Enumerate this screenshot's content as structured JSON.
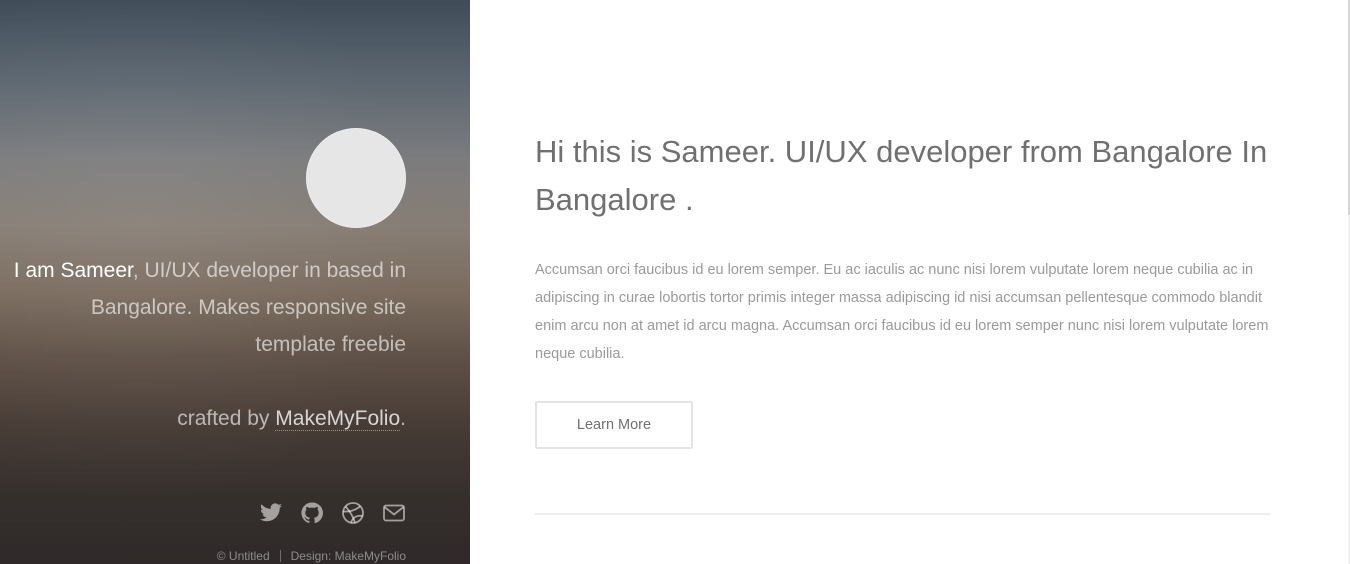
{
  "sidebar": {
    "intro_name": "I am Sameer",
    "intro_rest": ", UI/UX developer in based in Bangalore. Makes responsive site template freebie",
    "crafted_prefix": "crafted by ",
    "crafted_link": "MakeMyFolio",
    "crafted_suffix": ".",
    "social_icons": [
      "twitter-icon",
      "github-icon",
      "dribbble-icon",
      "mail-icon"
    ],
    "copyright": "© Untitled",
    "design_credit": "Design: MakeMyFolio"
  },
  "main": {
    "headline": "Hi this is Sameer. UI/UX developer from Bangalore In Bangalore .",
    "body": "Accumsan orci faucibus id eu lorem semper. Eu ac iaculis ac nunc nisi lorem vulputate lorem neque cubilia ac in adipiscing in curae lobortis tortor primis integer massa adipiscing id nisi accumsan pellentesque commodo blandit enim arcu non at amet id arcu magna. Accumsan orci faucibus id eu lorem semper nunc nisi lorem vulputate lorem neque cubilia.",
    "button_label": "Learn More"
  },
  "colors": {
    "headline": "#707070",
    "body_text": "#9a9a9a",
    "button_border": "#e4e4e4"
  }
}
